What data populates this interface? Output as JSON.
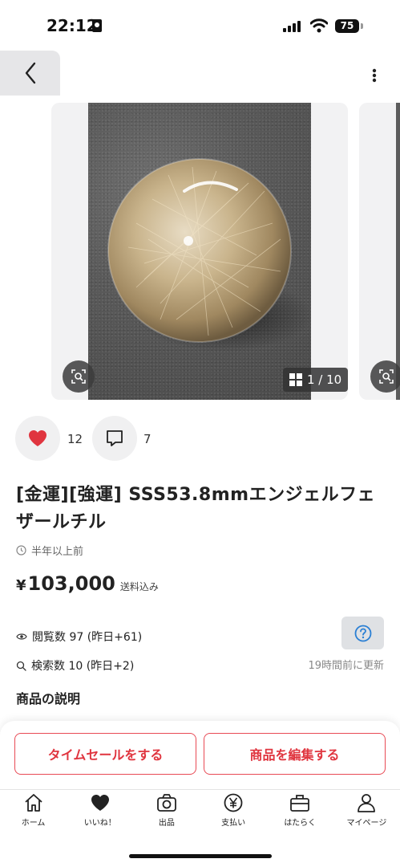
{
  "status_bar": {
    "time": "22:12",
    "battery": "75"
  },
  "carousel": {
    "counter": "1 / 10"
  },
  "actions": {
    "likes": "12",
    "comments": "7"
  },
  "item": {
    "title": "[金運][強運]  SSS53.8mmエンジェルフェザールチル",
    "posted": "半年以上前",
    "price_symbol": "¥",
    "price": "103,000",
    "shipping": "送料込み"
  },
  "stats": {
    "views": "閲覧数  97 (昨日+61)",
    "searches": "検索数  10 (昨日+2)",
    "updated": "19時間前に更新"
  },
  "description_heading": "商品の説明",
  "buttons": {
    "time_sale": "タイムセールをする",
    "edit": "商品を編集する"
  },
  "tabbar": {
    "home": "ホーム",
    "likes": "いいね！",
    "sell": "出品",
    "pay": "支払い",
    "work": "はたらく",
    "mypage": "マイページ"
  },
  "colors": {
    "accent": "#e0353f",
    "heart": "#e0353f",
    "help": "#2a7fd4"
  }
}
